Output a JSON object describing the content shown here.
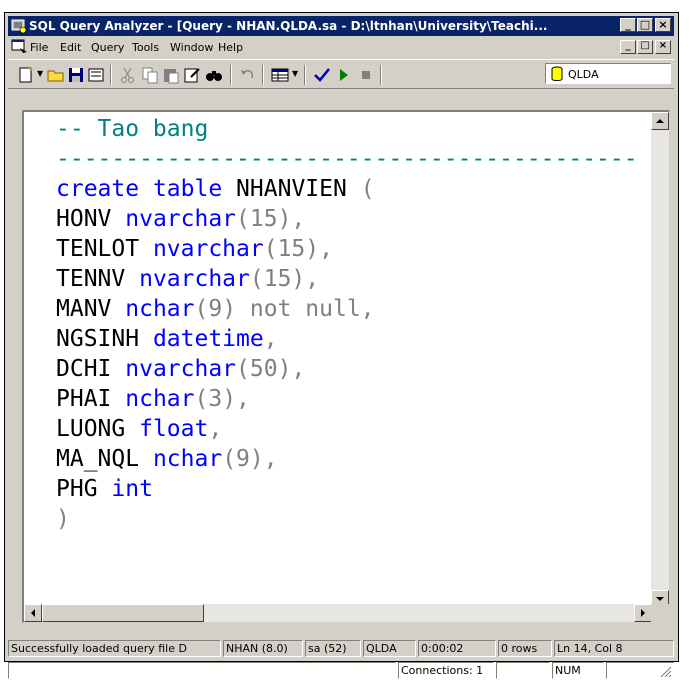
{
  "window": {
    "title": "SQL Query Analyzer - [Query - NHAN.QLDA.sa - D:\\ltnhan\\University\\Teachi...",
    "minimize_glyph": "_",
    "restore_glyph": "□",
    "close_glyph": "×"
  },
  "menu": {
    "items": [
      {
        "label": "File"
      },
      {
        "label": "Edit"
      },
      {
        "label": "Query"
      },
      {
        "label": "Tools"
      },
      {
        "label": "Window"
      },
      {
        "label": "Help"
      }
    ]
  },
  "toolbar": {
    "database": "QLDA",
    "icons": [
      "new-query-icon",
      "open-icon",
      "save-icon",
      "load-script-icon",
      "cut-icon",
      "copy-icon",
      "paste-icon",
      "edit-icon",
      "find-icon",
      "undo-icon",
      "results-grid-icon",
      "parse-icon",
      "execute-icon",
      "stop-icon",
      "database-icon"
    ]
  },
  "editor": {
    "lines": [
      [
        {
          "t": "-- Tao bang",
          "c": "comment"
        }
      ],
      [
        {
          "t": "------------------------------------------",
          "c": "comment"
        }
      ],
      [
        {
          "t": "create",
          "c": "kw"
        },
        {
          "t": " "
        },
        {
          "t": "table",
          "c": "kw"
        },
        {
          "t": " NHANVIEN "
        },
        {
          "t": "(",
          "c": "gray"
        }
      ],
      [
        {
          "t": "HONV "
        },
        {
          "t": "nvarchar",
          "c": "kw"
        },
        {
          "t": "(15),",
          "c": "gray"
        }
      ],
      [
        {
          "t": "TENLOT "
        },
        {
          "t": "nvarchar",
          "c": "kw"
        },
        {
          "t": "(15),",
          "c": "gray"
        }
      ],
      [
        {
          "t": "TENNV "
        },
        {
          "t": "nvarchar",
          "c": "kw"
        },
        {
          "t": "(15),",
          "c": "gray"
        }
      ],
      [
        {
          "t": "MANV "
        },
        {
          "t": "nchar",
          "c": "kw"
        },
        {
          "t": "(9) not null,",
          "c": "gray"
        }
      ],
      [
        {
          "t": "NGSINH "
        },
        {
          "t": "datetime",
          "c": "kw"
        },
        {
          "t": ",",
          "c": "gray"
        }
      ],
      [
        {
          "t": "DCHI "
        },
        {
          "t": "nvarchar",
          "c": "kw"
        },
        {
          "t": "(50),",
          "c": "gray"
        }
      ],
      [
        {
          "t": "PHAI "
        },
        {
          "t": "nchar",
          "c": "kw"
        },
        {
          "t": "(3),",
          "c": "gray"
        }
      ],
      [
        {
          "t": "LUONG "
        },
        {
          "t": "float",
          "c": "kw"
        },
        {
          "t": ",",
          "c": "gray"
        }
      ],
      [
        {
          "t": "MA_NQL "
        },
        {
          "t": "nchar",
          "c": "kw"
        },
        {
          "t": "(9),",
          "c": "gray"
        }
      ],
      [
        {
          "t": "PHG "
        },
        {
          "t": "int",
          "c": "kw"
        }
      ],
      [
        {
          "t": ")",
          "c": "gray"
        }
      ]
    ]
  },
  "status": {
    "message": "Successfully loaded query file D",
    "server": "NHAN (8.0)",
    "user": "sa (52)",
    "database": "QLDA",
    "elapsed": "0:00:02",
    "rows": "0 rows",
    "position": "Ln 14, Col 8",
    "connections": "Connections: 1",
    "num": "NUM"
  },
  "colors": {
    "titlebar": "#0a246a",
    "comment": "#008080",
    "keyword": "#0000ff",
    "punctuation": "#808080"
  }
}
